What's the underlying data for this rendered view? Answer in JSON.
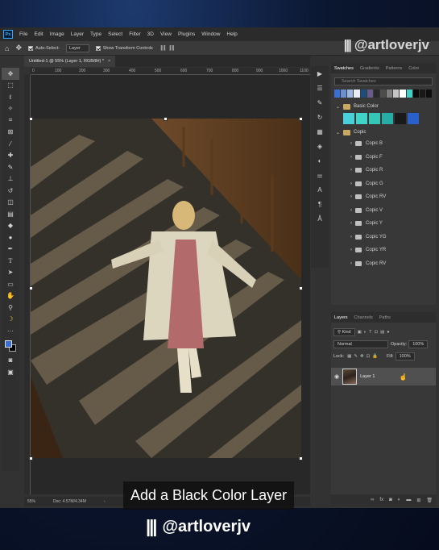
{
  "menu": [
    "File",
    "Edit",
    "Image",
    "Layer",
    "Type",
    "Select",
    "Filter",
    "3D",
    "View",
    "Plugins",
    "Window",
    "Help"
  ],
  "app_logo": "Ps",
  "options": {
    "auto_select_label": "Auto-Select:",
    "auto_select_value": "Layer",
    "show_transform_label": "Show Transform Controls"
  },
  "watermark": "@artloverjv",
  "document_tab": "Untitled-1 @ 55% (Layer 1, RGB/8#) *",
  "ruler_ticks": [
    "0",
    "100",
    "200",
    "300",
    "400",
    "500",
    "600",
    "700",
    "800",
    "900",
    "1000",
    "1100"
  ],
  "status": {
    "zoom": "55%",
    "doc": "Doc: 4.57M/4.34M"
  },
  "caption": "Add a Black Color Layer",
  "swatches_panel": {
    "tabs": [
      "Swatches",
      "Gradients",
      "Patterns",
      "Color"
    ],
    "search_placeholder": "Search Swatches",
    "recent_colors": [
      "#3b6fd4",
      "#6c8fd0",
      "#9cb7e0",
      "#e9eef6",
      "#1d4d7a",
      "#6a5a8a",
      "#2a2a2a",
      "#4e4e4e",
      "#7e7e7e",
      "#c4c4c4",
      "#ffffff",
      "#44d0c8",
      "#0a0a0a",
      "#181818",
      "#0e0e0e"
    ],
    "group_name": "Basic Color",
    "group_colors": [
      "#48cfd9",
      "#40d4c8",
      "#35c6b6",
      "#27aca6",
      "#1a1a1a",
      "#2a60c9"
    ],
    "copic_group": "Copic",
    "copic_items": [
      "Copic B",
      "Copic F",
      "Copic R",
      "Copic G",
      "Copic RV",
      "Copic V",
      "Copic Y",
      "Copic YG",
      "Copic YR",
      "Copic RV"
    ]
  },
  "layers_panel": {
    "tabs": [
      "Layers",
      "Channels",
      "Paths"
    ],
    "kind_label": "Kind",
    "blend_mode": "Normal",
    "opacity_label": "Opacity:",
    "opacity_value": "100%",
    "lock_label": "Lock:",
    "fill_label": "Fill:",
    "fill_value": "100%",
    "layer_name": "Layer 1"
  },
  "tools": [
    "move-tool",
    "artboard-tool",
    "lasso-tool",
    "magic-wand-tool",
    "crop-tool",
    "frame-tool",
    "eyedropper-tool",
    "spot-healing-tool",
    "brush-tool",
    "clone-stamp-tool",
    "history-brush-tool",
    "eraser-tool",
    "gradient-tool",
    "blur-tool",
    "dodge-tool",
    "pen-tool",
    "type-tool",
    "path-selection-tool",
    "rectangle-tool",
    "hand-tool",
    "zoom-tool",
    "banana-tool",
    "color-swatches",
    "quick-mask",
    "screen-mode"
  ],
  "colors": {
    "accent": "#31a8ff",
    "foreground": "#3b6fd4",
    "background": "#000000"
  }
}
